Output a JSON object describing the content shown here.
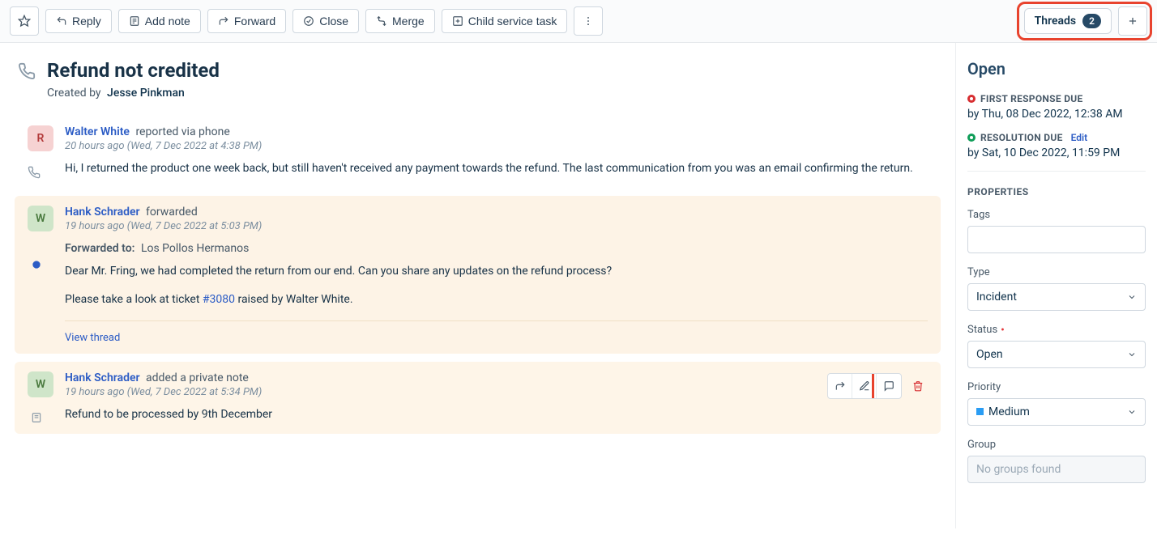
{
  "toolbar": {
    "reply": "Reply",
    "add_note": "Add note",
    "forward": "Forward",
    "close": "Close",
    "merge": "Merge",
    "child_task": "Child service task",
    "threads_label": "Threads",
    "threads_count": "2"
  },
  "ticket": {
    "title": "Refund not credited",
    "created_by_label": "Created by",
    "creator": "Jesse Pinkman"
  },
  "messages": [
    {
      "avatar_bg": "#f6d2d2",
      "avatar_fg": "#b23a3a",
      "avatar_letter": "R",
      "name": "Walter White",
      "verb": "reported via phone",
      "meta": "20 hours ago (Wed, 7 Dec 2022 at 4:38 PM)",
      "text": "Hi, I returned the product one week back, but still haven't received any payment towards the refund. The last communication from you was an email confirming the return."
    },
    {
      "avatar_bg": "#cfe5c9",
      "avatar_fg": "#4a7a3f",
      "avatar_letter": "W",
      "name": "Hank Schrader",
      "verb": "forwarded",
      "meta": "19 hours ago (Wed, 7 Dec 2022 at 5:03 PM)",
      "forwarded_to_label": "Forwarded to:",
      "forwarded_to": "Los Pollos Hermanos",
      "line1": "Dear Mr. Fring, we had completed the return from our end. Can you share any updates on the refund process?",
      "line2a": "Please take a look at ticket ",
      "ticket_ref": "#3080",
      "line2b": " raised by Walter White.",
      "view_thread": "View thread"
    },
    {
      "avatar_bg": "#cfe5c9",
      "avatar_fg": "#4a7a3f",
      "avatar_letter": "W",
      "name": "Hank Schrader",
      "verb": "added a private note",
      "meta": "19 hours ago (Wed, 7 Dec 2022 at 5:34 PM)",
      "text": "Refund to be processed by 9th December"
    }
  ],
  "side": {
    "status_title": "Open",
    "first_response_label": "FIRST RESPONSE DUE",
    "first_response_text": "by Thu, 08 Dec 2022, 12:38 AM",
    "resolution_label": "RESOLUTION DUE",
    "resolution_edit": "Edit",
    "resolution_text": "by Sat, 10 Dec 2022, 11:59 PM",
    "properties_head": "PROPERTIES",
    "tags_label": "Tags",
    "type_label": "Type",
    "type_value": "Incident",
    "status_label": "Status",
    "status_value": "Open",
    "priority_label": "Priority",
    "priority_value": "Medium",
    "group_label": "Group",
    "group_placeholder": "No groups found"
  }
}
